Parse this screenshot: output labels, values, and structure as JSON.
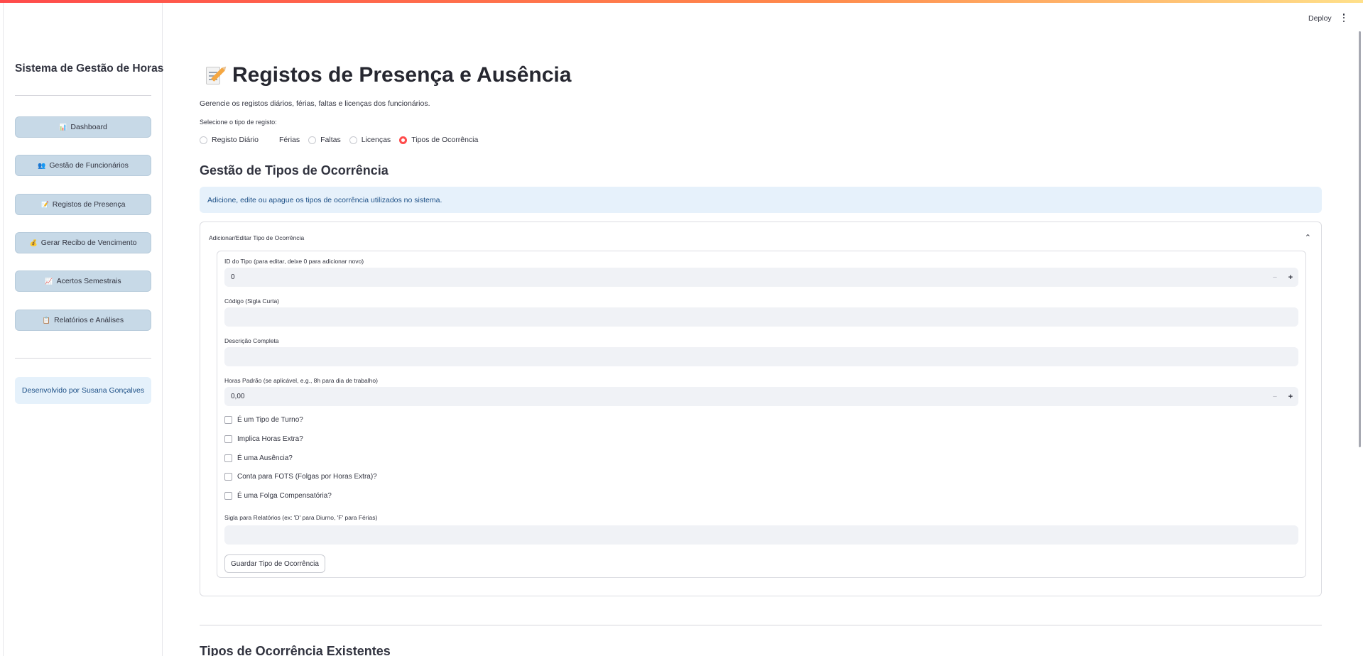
{
  "header": {
    "deploy_label": "Deploy",
    "menu_icon": "kebab-menu-icon"
  },
  "sidebar": {
    "title": "Sistema de Gestão de Horas",
    "items": [
      {
        "icon": "📊",
        "icon_name": "bar-chart-icon",
        "label": "Dashboard"
      },
      {
        "icon": "👥",
        "icon_name": "users-icon",
        "label": "Gestão de Funcionários"
      },
      {
        "icon": "📝",
        "icon_name": "memo-icon",
        "label": "Registos de Presença"
      },
      {
        "icon": "💰",
        "icon_name": "money-bag-icon",
        "label": "Gerar Recibo de Vencimento"
      },
      {
        "icon": "📈",
        "icon_name": "trend-chart-icon",
        "label": "Acertos Semestrais"
      },
      {
        "icon": "📋",
        "icon_name": "clipboard-icon",
        "label": "Relatórios e Análises"
      }
    ],
    "footer_info": "Desenvolvido por Susana Gonçalves"
  },
  "main": {
    "title": "Registos de Presença e Ausência",
    "subtitle": "Gerencie os registos diários, férias, faltas e licenças dos funcionários.",
    "radio_label": "Selecione o tipo de registo:",
    "radio_options": [
      "Registo Diário",
      "Férias",
      "Faltas",
      "Licenças",
      "Tipos de Ocorrência"
    ],
    "radio_selected": "Tipos de Ocorrência",
    "section_title": "Gestão de Tipos de Ocorrência",
    "info": "Adicione, edite ou apague os tipos de ocorrência utilizados no sistema.",
    "expander": {
      "title": "Adicionar/Editar Tipo de Ocorrência",
      "fields": {
        "id_label": "ID do Tipo (para editar, deixe 0 para adicionar novo)",
        "id_value": "0",
        "codigo_label": "Código (Sigla Curta)",
        "codigo_value": "",
        "descricao_label": "Descrição Completa",
        "descricao_value": "",
        "horas_label": "Horas Padrão (se aplicável, e.g., 8h para dia de trabalho)",
        "horas_value": "0,00",
        "checkboxes": [
          "É um Tipo de Turno?",
          "Implica Horas Extra?",
          "É uma Ausência?",
          "Conta para FOTS (Folgas por Horas Extra)?",
          "É uma Folga Compensatória?"
        ],
        "sigla_label": "Sigla para Relatórios (ex: 'D' para Diurno, 'F' para Férias)",
        "sigla_value": ""
      },
      "save_label": "Guardar Tipo de Ocorrência"
    },
    "bottom_title": "Tipos de Ocorrência Existentes"
  }
}
